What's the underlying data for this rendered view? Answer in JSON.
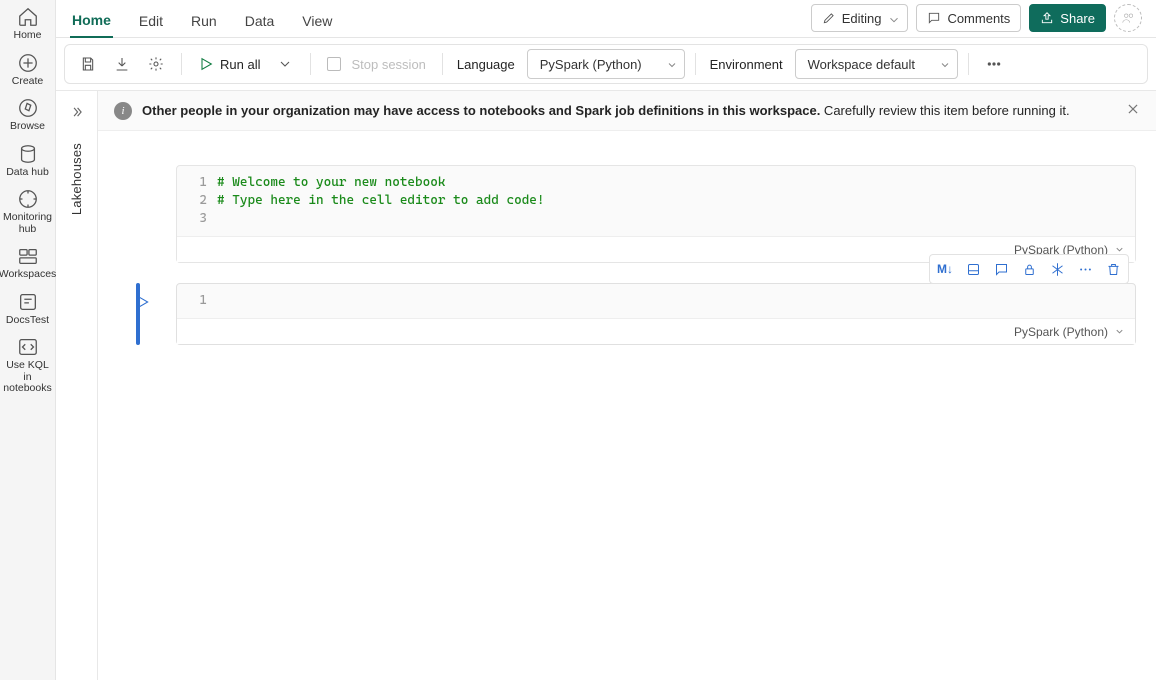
{
  "rail": [
    {
      "id": "home",
      "label": "Home"
    },
    {
      "id": "create",
      "label": "Create"
    },
    {
      "id": "browse",
      "label": "Browse"
    },
    {
      "id": "datahub",
      "label": "Data hub"
    },
    {
      "id": "monitor",
      "label": "Monitoring hub"
    },
    {
      "id": "workspaces",
      "label": "Workspaces"
    },
    {
      "id": "docstest",
      "label": "DocsTest"
    },
    {
      "id": "kql",
      "label": "Use KQL in notebooks"
    }
  ],
  "tabs": [
    {
      "id": "home",
      "label": "Home",
      "active": true
    },
    {
      "id": "edit",
      "label": "Edit"
    },
    {
      "id": "run",
      "label": "Run"
    },
    {
      "id": "data",
      "label": "Data"
    },
    {
      "id": "view",
      "label": "View"
    }
  ],
  "top_actions": {
    "editing": "Editing",
    "comments": "Comments",
    "share": "Share"
  },
  "toolbar": {
    "run_all": "Run all",
    "stop_session": "Stop session",
    "language_label": "Language",
    "language_value": "PySpark (Python)",
    "environment_label": "Environment",
    "environment_value": "Workspace default"
  },
  "side_panel": {
    "label": "Lakehouses"
  },
  "banner": {
    "bold": "Other people in your organization may have access to notebooks and Spark job definitions in this workspace.",
    "rest": " Carefully review this item before running it."
  },
  "cells": [
    {
      "lines": [
        "# Welcome to your new notebook",
        "# Type here in the cell editor to add code!",
        ""
      ],
      "language": "PySpark (Python)"
    },
    {
      "lines": [
        ""
      ],
      "language": "PySpark (Python)",
      "active": true
    }
  ],
  "cell_toolbar_md": "M↓"
}
